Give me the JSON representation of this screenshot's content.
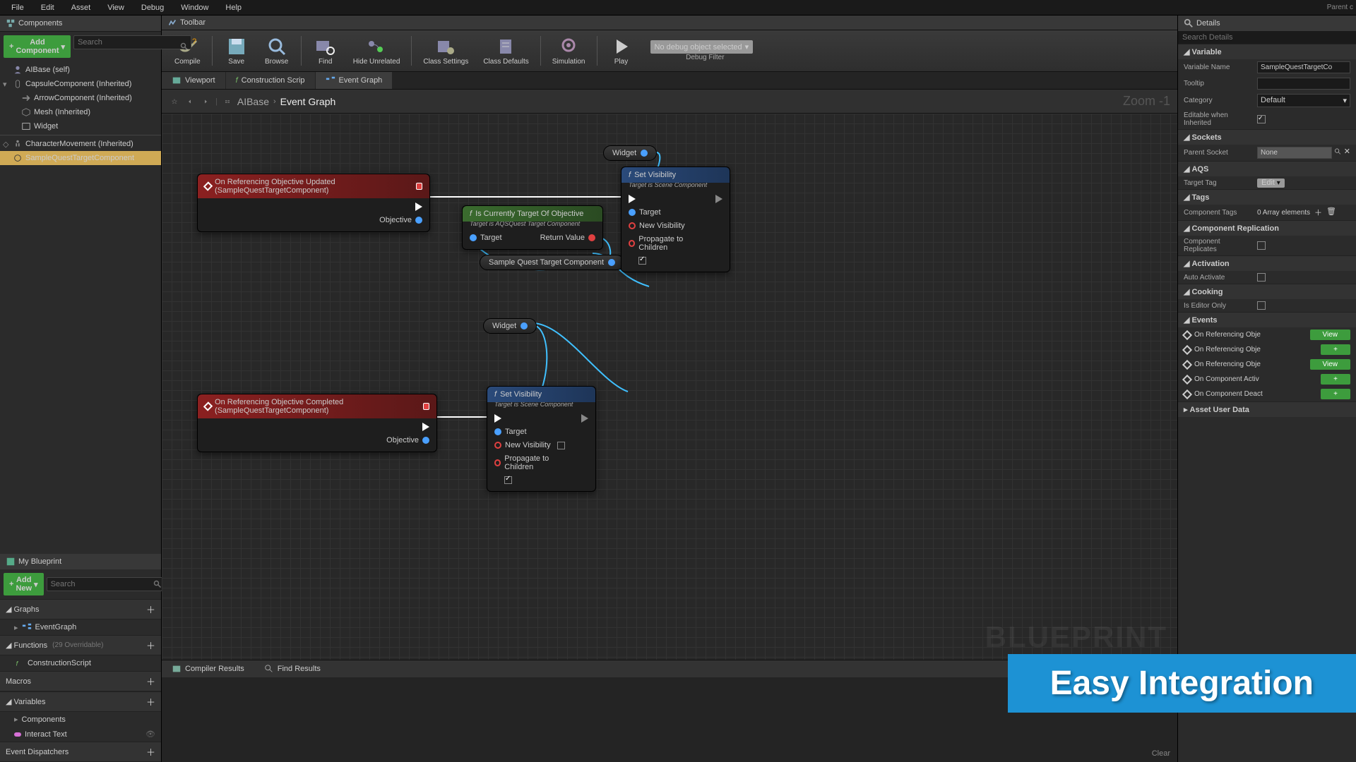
{
  "menubar": {
    "items": [
      "File",
      "Edit",
      "Asset",
      "View",
      "Debug",
      "Window",
      "Help"
    ],
    "right": "Parent c"
  },
  "components": {
    "tab": "Components",
    "add": "Add Component",
    "search_ph": "Search",
    "tree": [
      {
        "label": "AIBase (self)",
        "indent": 0,
        "dark": false
      },
      {
        "label": "CapsuleComponent (Inherited)",
        "indent": 0,
        "dark": true,
        "caret": "▾"
      },
      {
        "label": "ArrowComponent (Inherited)",
        "indent": 1,
        "dark": true
      },
      {
        "label": "Mesh (Inherited)",
        "indent": 1,
        "dark": true
      },
      {
        "label": "Widget",
        "indent": 1,
        "dark": false
      },
      {
        "label": "CharacterMovement (Inherited)",
        "indent": 0,
        "dark": true,
        "caret": "◇",
        "sep": true
      },
      {
        "label": "SampleQuestTargetComponent",
        "indent": 0,
        "dark": false,
        "selected": true
      }
    ]
  },
  "myblueprint": {
    "tab": "My Blueprint",
    "add": "Add New",
    "search_ph": "Search",
    "sections": {
      "graphs": {
        "title": "Graphs",
        "items": [
          {
            "label": "EventGraph",
            "icon": "graph"
          }
        ]
      },
      "functions": {
        "title": "Functions",
        "hint": "(29 Overridable)",
        "items": [
          {
            "label": "ConstructionScript",
            "icon": "func"
          }
        ]
      },
      "macros": {
        "title": "Macros",
        "items": []
      },
      "variables": {
        "title": "Variables",
        "items": [
          {
            "label": "Components",
            "sub": true
          },
          {
            "label": "Interact Text",
            "var": true
          }
        ]
      },
      "dispatchers": {
        "title": "Event Dispatchers",
        "items": []
      }
    }
  },
  "toolbar": {
    "tab": "Toolbar",
    "buttons": [
      "Compile",
      "Save",
      "Browse",
      "Find",
      "Hide Unrelated",
      "Class Settings",
      "Class Defaults",
      "Simulation",
      "Play"
    ],
    "debug_sel": "No debug object selected",
    "debug_lbl": "Debug Filter"
  },
  "graph_tabs": [
    "Viewport",
    "Construction Scrip",
    "Event Graph"
  ],
  "nav": {
    "parent": "AIBase",
    "current": "Event Graph",
    "zoom": "Zoom  -1"
  },
  "nodes": {
    "event1": {
      "title": "On Referencing Objective Updated (SampleQuestTargetComponent)",
      "pin": "Objective"
    },
    "event2": {
      "title": "On Referencing Objective Completed (SampleQuestTargetComponent)",
      "pin": "Objective"
    },
    "func_g": {
      "title": "Is Currently Target Of Objective",
      "sub": "Target is AQSQuest Target Component",
      "in": "Target",
      "out": "Return Value"
    },
    "setvis1": {
      "title": "Set Visibility",
      "sub": "Target is Scene Component",
      "pins": [
        "Target",
        "New Visibility",
        "Propagate to Children"
      ]
    },
    "setvis2": {
      "title": "Set Visibility",
      "sub": "Target is Scene Component",
      "pins": [
        "Target",
        "New Visibility",
        "Propagate to Children"
      ]
    },
    "pill_widget": "Widget",
    "pill_sample": "Sample Quest Target Component"
  },
  "watermark": "BLUEPRINT",
  "bottom": {
    "tabs": [
      "Compiler Results",
      "Find Results"
    ],
    "clear": "Clear"
  },
  "details": {
    "tab": "Details",
    "search_ph": "Search Details",
    "variable": {
      "hdr": "Variable",
      "name_lbl": "Variable Name",
      "name_val": "SampleQuestTargetCo",
      "tooltip_lbl": "Tooltip",
      "cat_lbl": "Category",
      "cat_val": "Default",
      "edit_lbl": "Editable when Inherited"
    },
    "sockets": {
      "hdr": "Sockets",
      "parent_lbl": "Parent Socket",
      "parent_val": "None"
    },
    "aqs": {
      "hdr": "AQS",
      "tag_lbl": "Target Tag",
      "tag_val": "Edit"
    },
    "tags": {
      "hdr": "Tags",
      "comp_lbl": "Component Tags",
      "comp_val": "0 Array elements"
    },
    "replication": {
      "hdr": "Component Replication",
      "lbl": "Component Replicates"
    },
    "activation": {
      "hdr": "Activation",
      "lbl": "Auto Activate"
    },
    "cooking": {
      "hdr": "Cooking",
      "lbl": "Is Editor Only"
    },
    "events": {
      "hdr": "Events",
      "items": [
        {
          "label": "On Referencing Obje",
          "btn": "View"
        },
        {
          "label": "On Referencing Obje",
          "btn": "+"
        },
        {
          "label": "On Referencing Obje",
          "btn": "View"
        },
        {
          "label": "On Component Activ",
          "btn": "+"
        },
        {
          "label": "On Component Deact",
          "btn": "+"
        }
      ]
    },
    "assetdata": {
      "hdr": "Asset User Data"
    }
  },
  "banner": "Easy Integration"
}
